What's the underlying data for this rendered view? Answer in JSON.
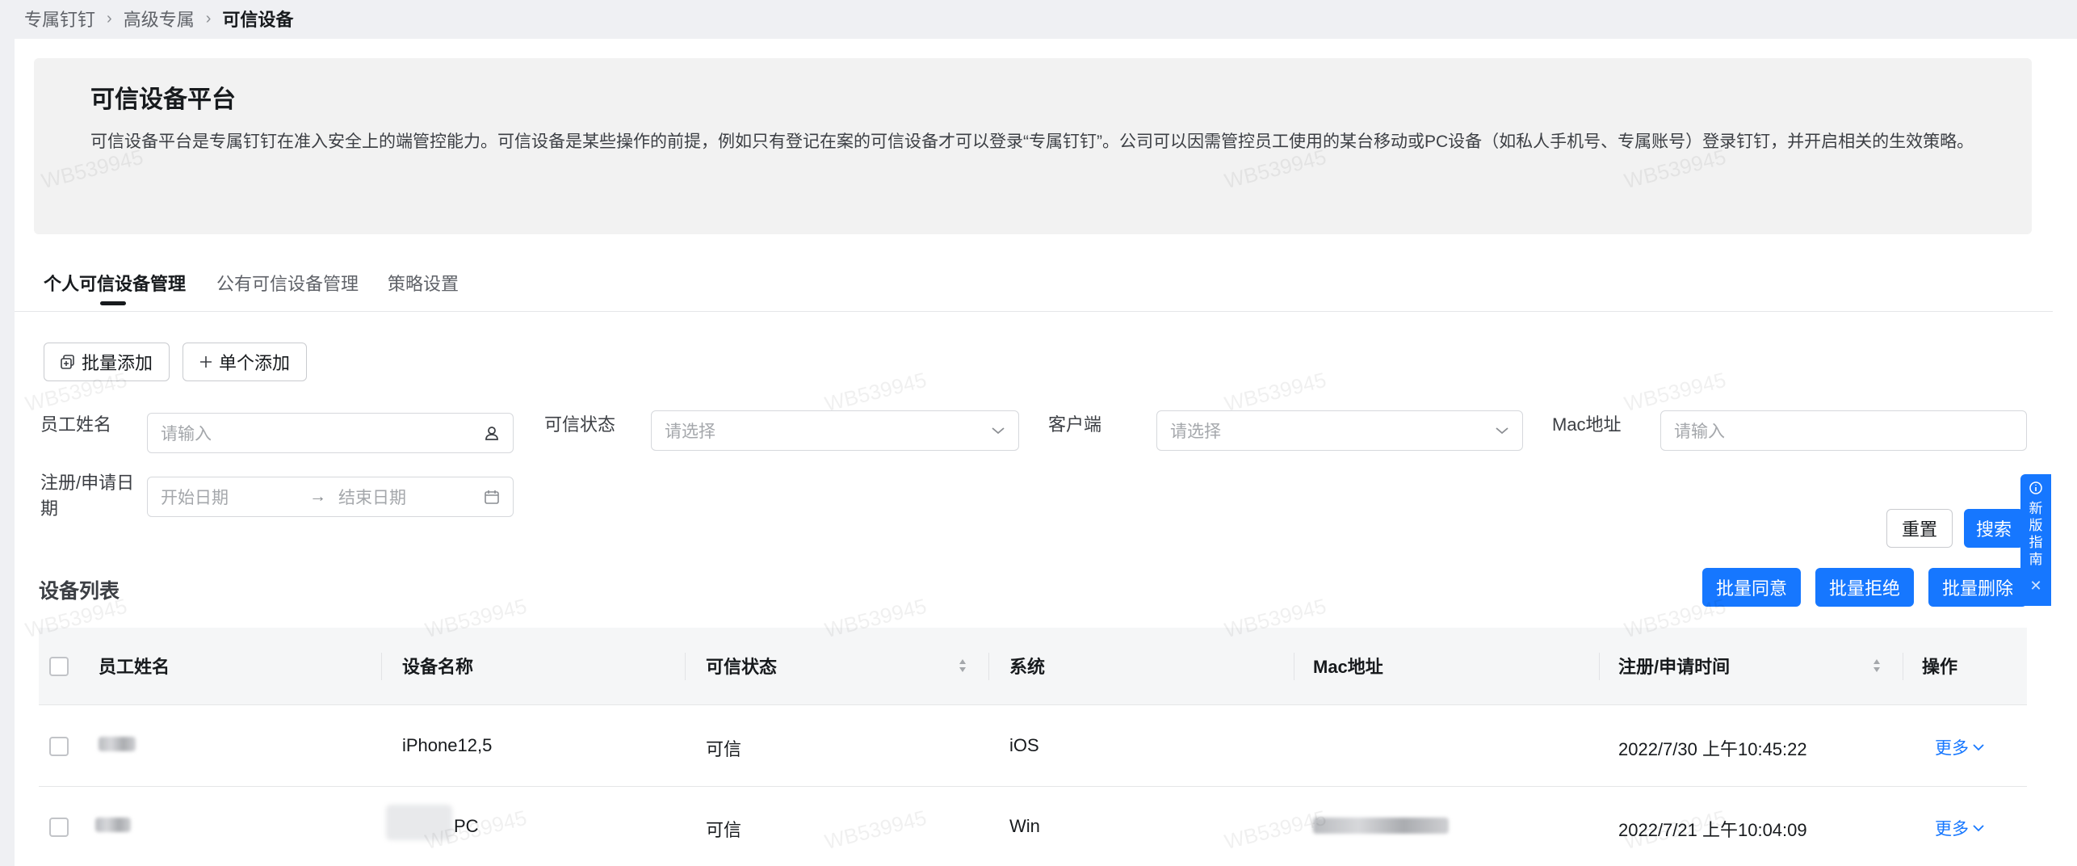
{
  "breadcrumb": [
    "专属钉钉",
    "高级专属",
    "可信设备"
  ],
  "intro": {
    "title": "可信设备平台",
    "description": "可信设备平台是专属钉钉在准入安全上的端管控能力。可信设备是某些操作的前提，例如只有登记在案的可信设备才可以登录“专属钉钉”。公司可以因需管控员工使用的某台移动或PC设备（如私人手机号、专属账号）登录钉钉，并开启相关的生效策略。"
  },
  "tabs": [
    "个人可信设备管理",
    "公有可信设备管理",
    "策略设置"
  ],
  "actions": {
    "batch_add": "批量添加",
    "single_add": "单个添加"
  },
  "filters": {
    "employee_name": {
      "label": "员工姓名",
      "placeholder": "请输入"
    },
    "trust_status": {
      "label": "可信状态",
      "placeholder": "请选择"
    },
    "client": {
      "label": "客户端",
      "placeholder": "请选择"
    },
    "mac": {
      "label": "Mac地址",
      "placeholder": "请输入"
    },
    "date": {
      "label": "注册/申请日期",
      "start": "开始日期",
      "end": "结束日期"
    },
    "reset": "重置",
    "search": "搜索"
  },
  "list": {
    "title": "设备列表",
    "batch_approve": "批量同意",
    "batch_reject": "批量拒绝",
    "batch_delete": "批量删除",
    "columns": [
      "员工姓名",
      "设备名称",
      "可信状态",
      "系统",
      "Mac地址",
      "注册/申请时间",
      "操作"
    ],
    "rows": [
      {
        "device": "iPhone12,5",
        "status": "可信",
        "system": "iOS",
        "time": "2022/7/30 上午10:45:22",
        "action": "更多"
      },
      {
        "device": "PC",
        "status": "可信",
        "system": "Win",
        "time": "2022/7/21 上午10:04:09",
        "action": "更多"
      }
    ]
  },
  "guide": {
    "text": "新版指南"
  },
  "watermark": "WB539945",
  "colors": {
    "primary": "#1677ff",
    "intro_bg": "#f2f2f2",
    "page_bg": "#eff0f3"
  }
}
